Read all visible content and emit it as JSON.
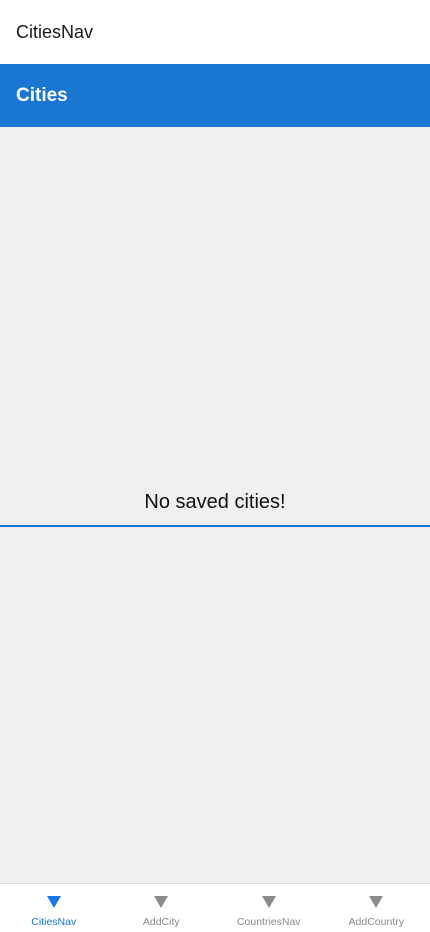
{
  "header": {
    "title": "CitiesNav"
  },
  "screen": {
    "title": "Cities",
    "accent_color": "#1976d2"
  },
  "content": {
    "empty_message": "No saved cities!"
  },
  "tabs": [
    {
      "label": "CitiesNav",
      "icon": "triangle-down-icon",
      "active": true
    },
    {
      "label": "AddCity",
      "icon": "triangle-down-icon",
      "active": false
    },
    {
      "label": "CountriesNav",
      "icon": "triangle-down-icon",
      "active": false
    },
    {
      "label": "AddCountry",
      "icon": "triangle-down-icon",
      "active": false
    }
  ],
  "colors": {
    "active_tab": "#1677e6",
    "inactive_tab": "#8a8a8a",
    "background": "#f0f0f0"
  }
}
